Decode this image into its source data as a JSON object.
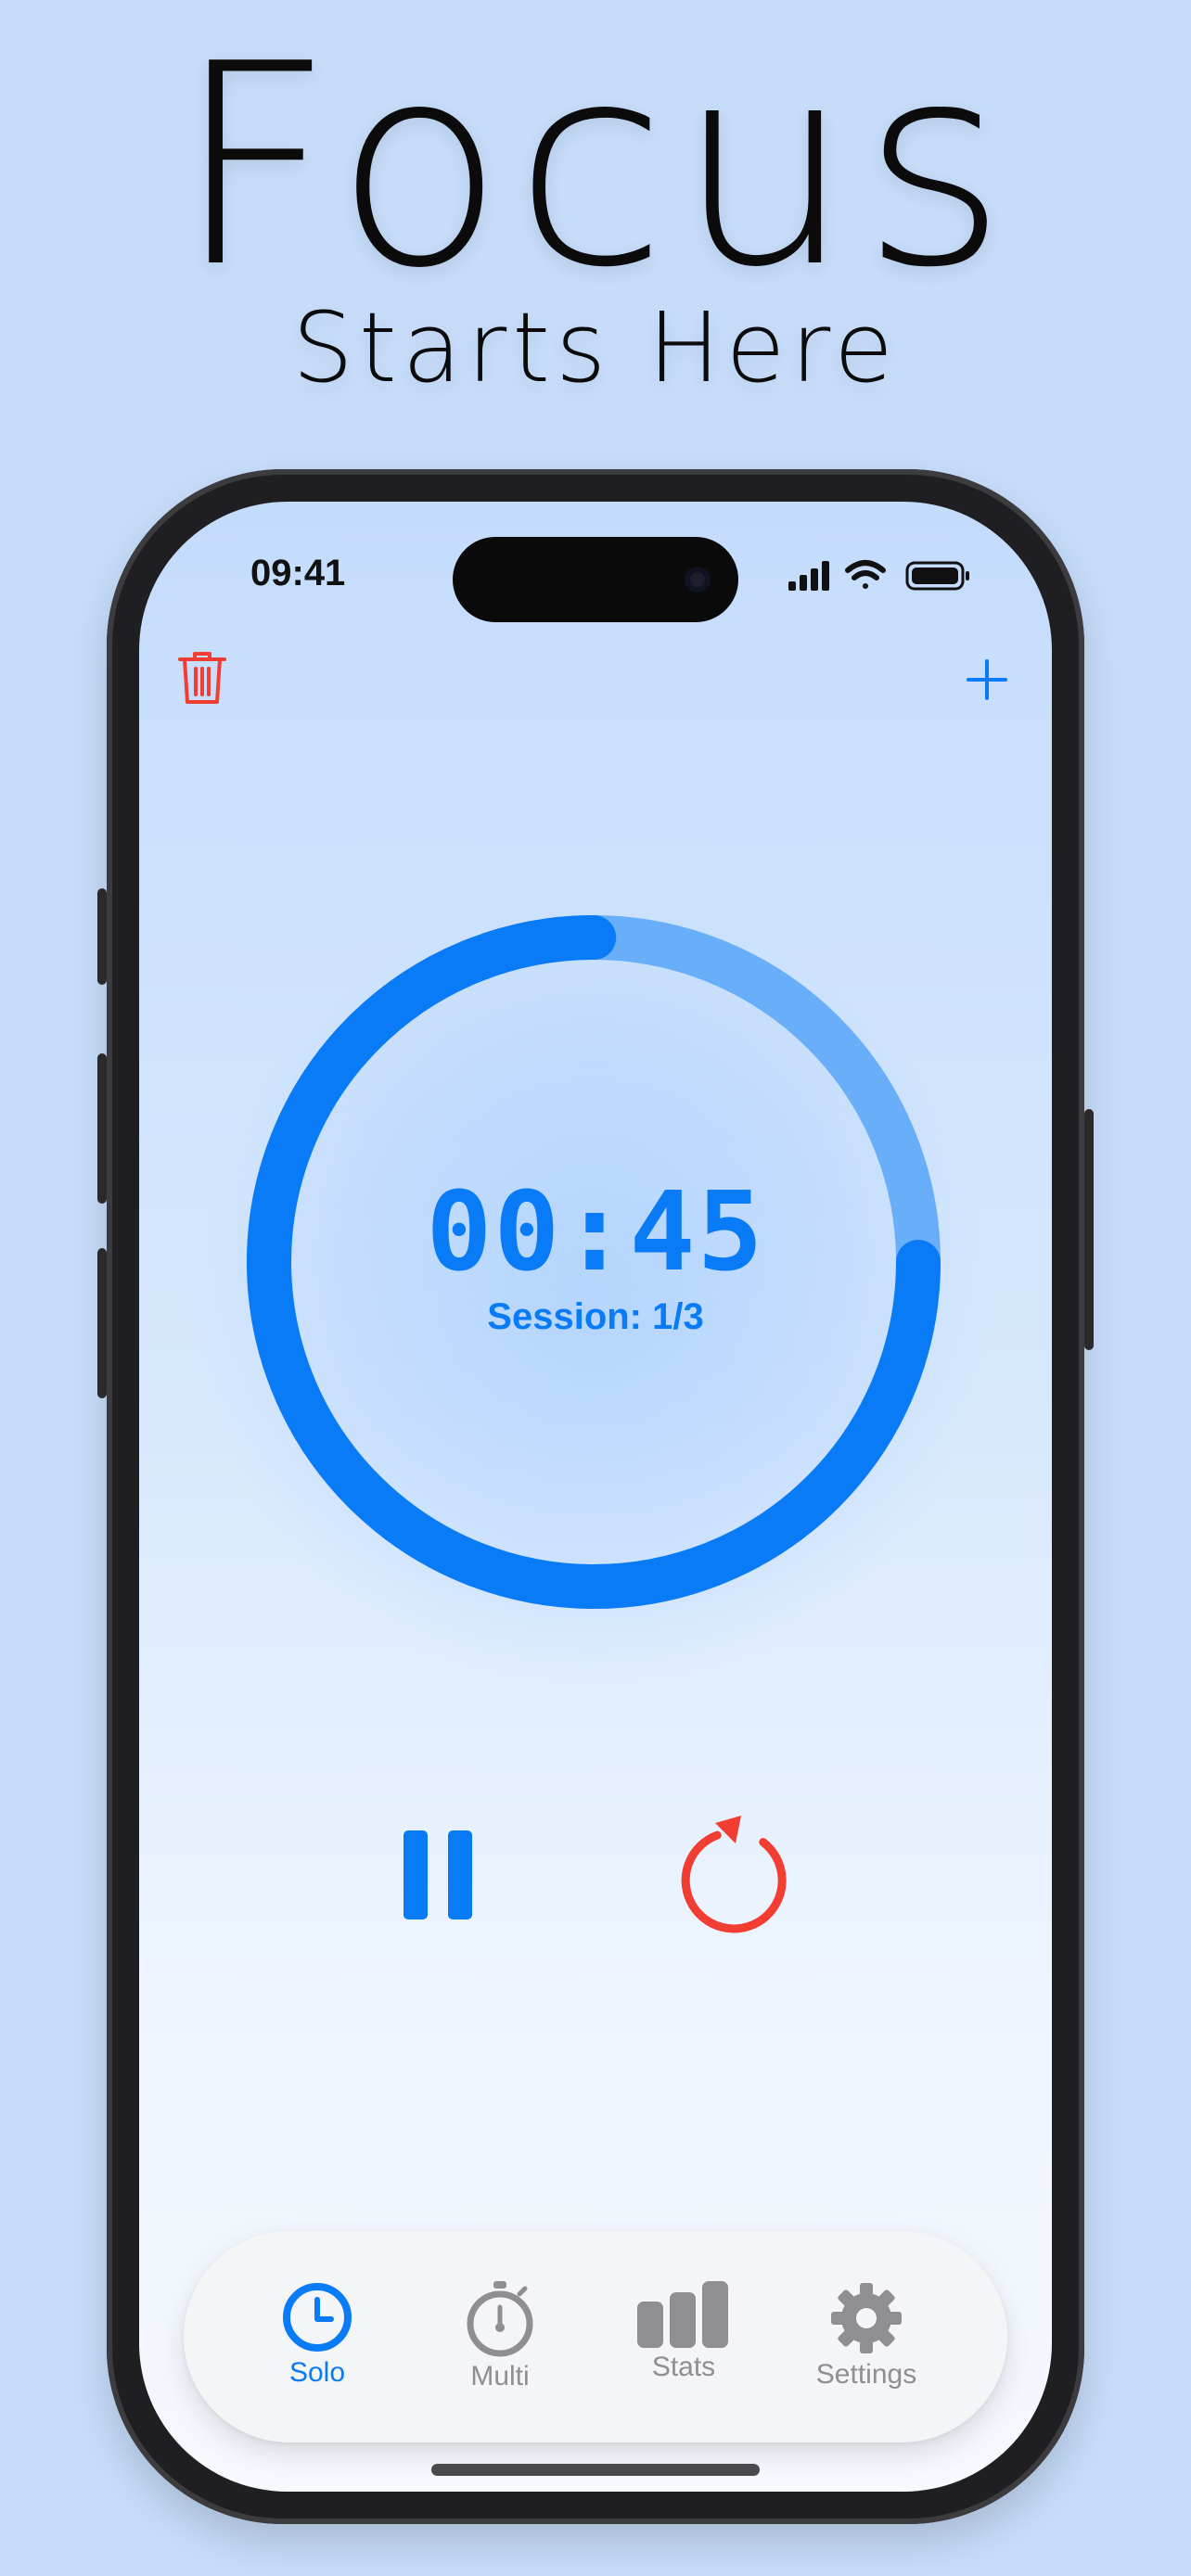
{
  "headline": {
    "title": "Focus",
    "subtitle": "Starts Here"
  },
  "status_bar": {
    "time": "09:41"
  },
  "timer": {
    "display": "00:45",
    "session": "Session: 1/3",
    "progress": 0.75
  },
  "colors": {
    "accent": "#0a7bf6",
    "accent_light": "#69aef9",
    "danger": "#f23d33",
    "inactive": "#8e8e93"
  },
  "icons": {
    "top_left": "trash-icon",
    "top_right": "plus-icon",
    "primary_control": "pause-icon",
    "secondary_control": "reset-icon"
  },
  "tabs": [
    {
      "label": "Solo",
      "icon": "clock-icon",
      "active": true
    },
    {
      "label": "Multi",
      "icon": "stopwatch-icon",
      "active": false
    },
    {
      "label": "Stats",
      "icon": "bar-chart-icon",
      "active": false
    },
    {
      "label": "Settings",
      "icon": "gear-icon",
      "active": false
    }
  ]
}
